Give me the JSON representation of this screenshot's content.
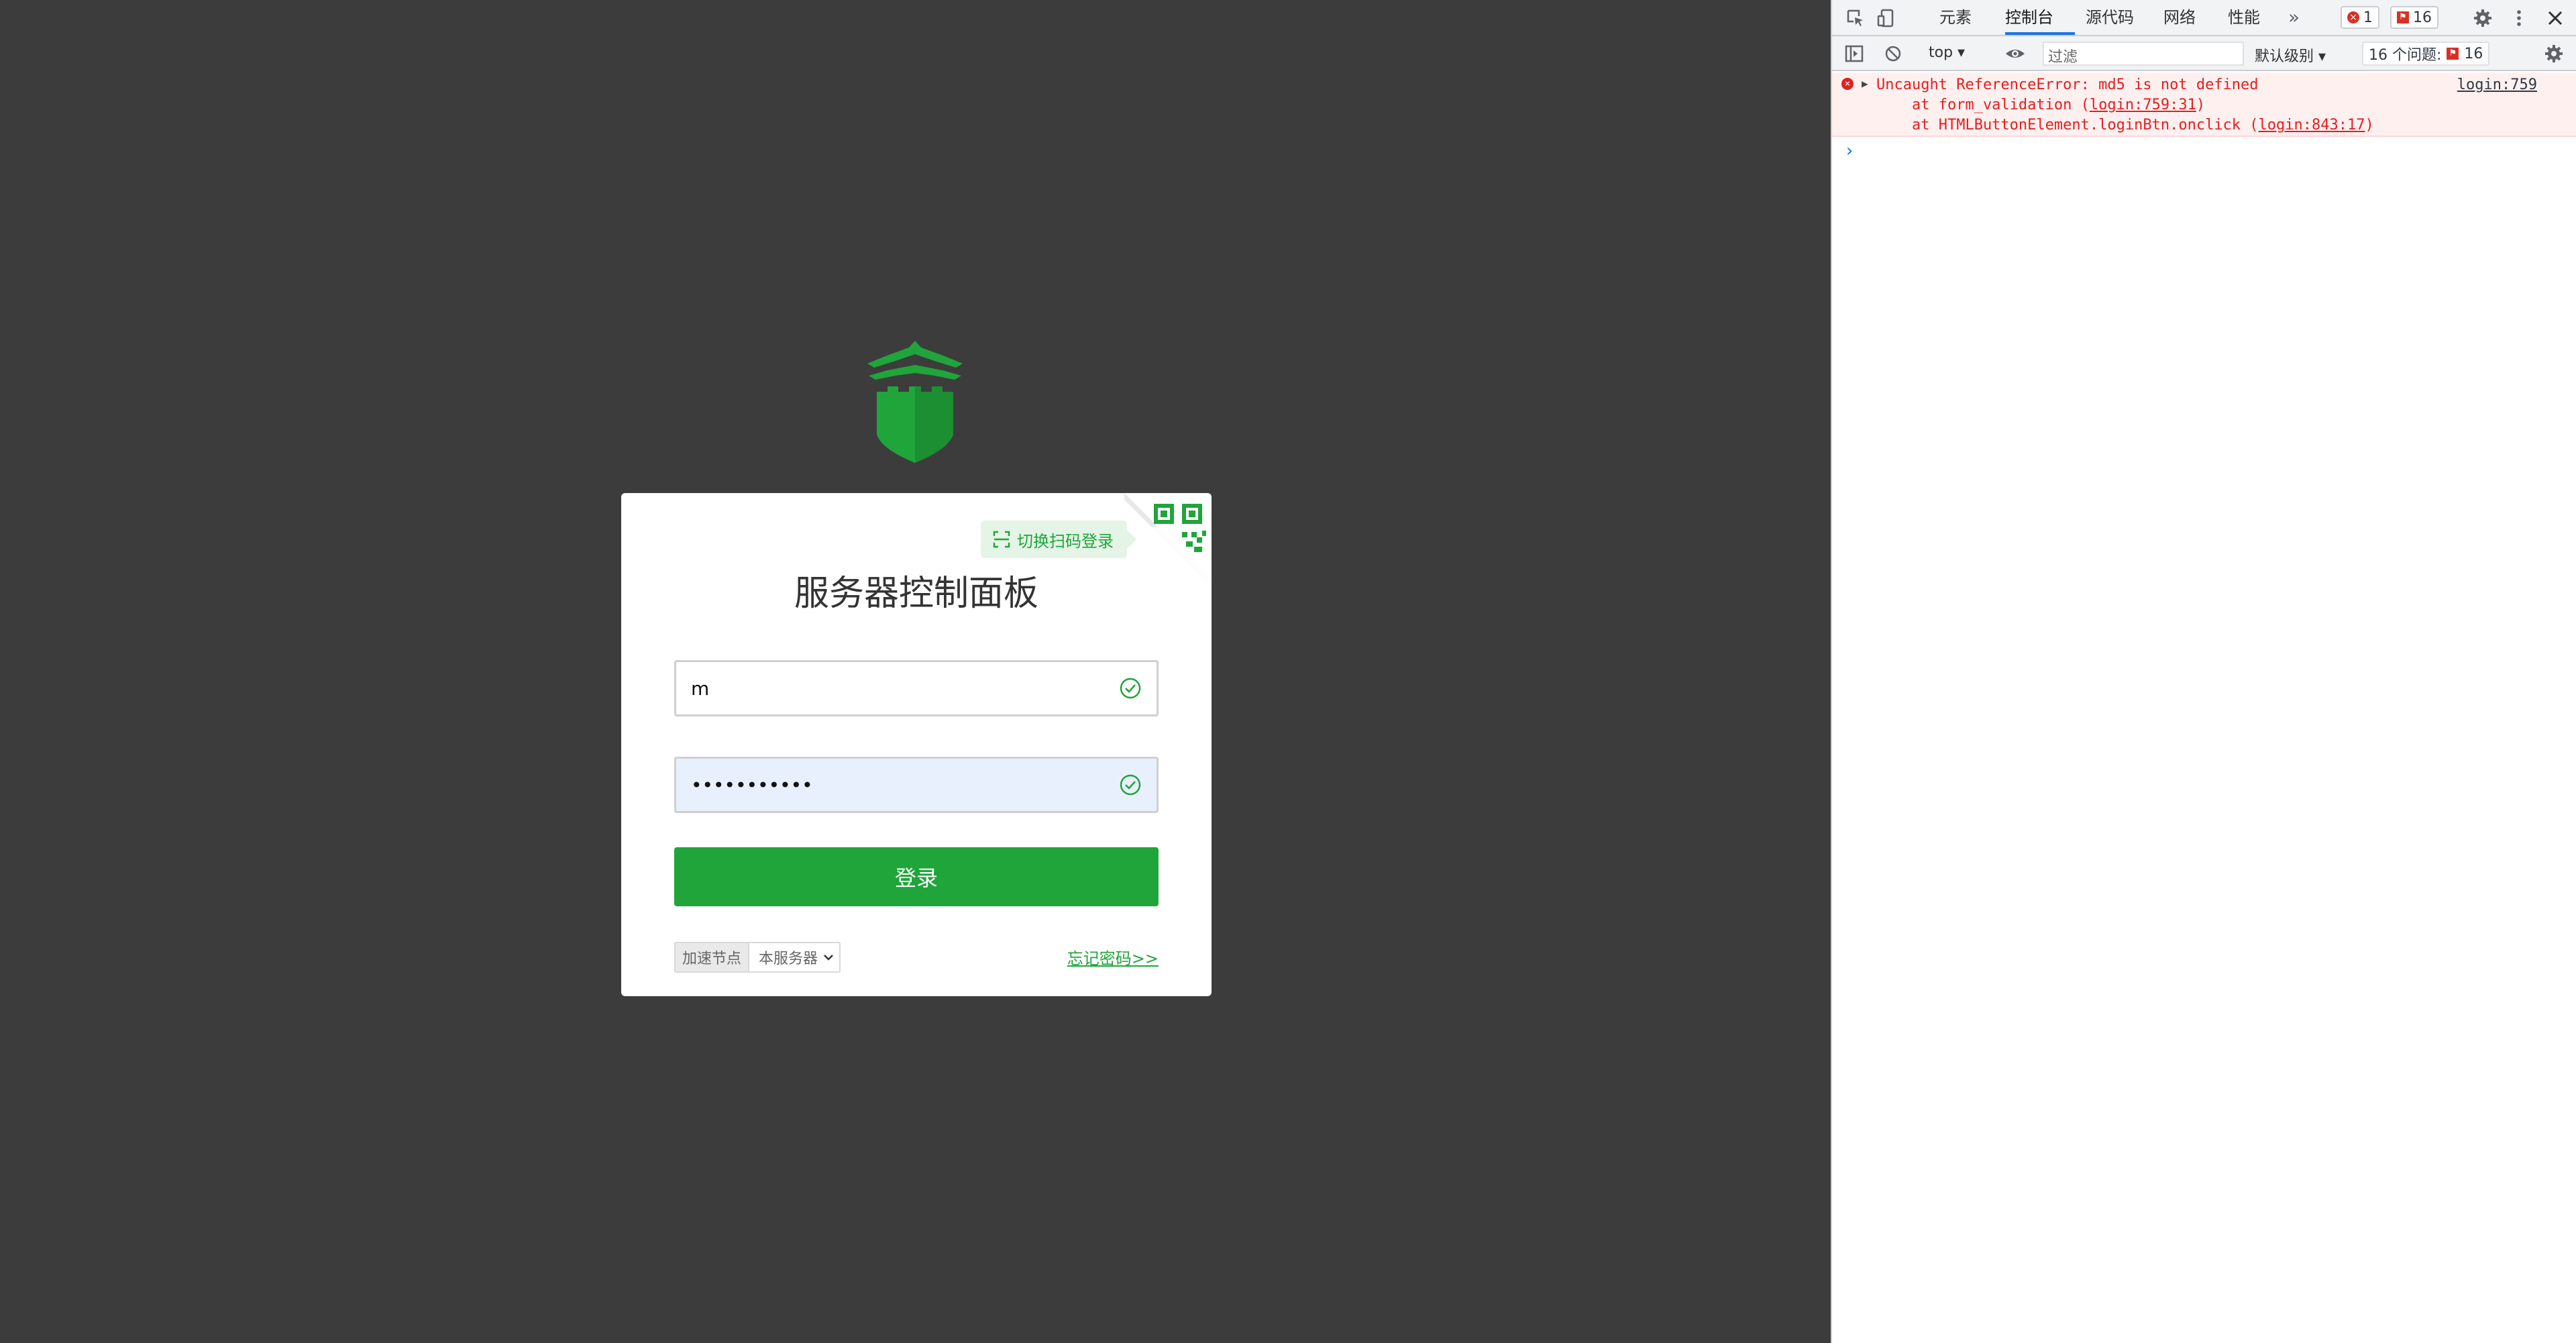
{
  "login": {
    "title": "服务器控制面板",
    "qr_tip": "切换扫码登录",
    "username_value": "m",
    "password_value": "•••••••••••",
    "login_button": "登录",
    "node_label": "加速节点",
    "node_selected": "本服务器",
    "forgot_link": "忘记密码>>"
  },
  "devtools": {
    "tabs": [
      "元素",
      "控制台",
      "源代码",
      "网络",
      "性能"
    ],
    "active_tab": "控制台",
    "error_count": "1",
    "issue_count": "16",
    "context": "top",
    "filter_placeholder": "过滤",
    "level": "默认级别",
    "issues_label": "16 个问题:",
    "issues_flag_count": "16",
    "error": {
      "message": "Uncaught ReferenceError: md5 is not defined",
      "source": "login:759",
      "frame1_prefix": "    at form_validation (",
      "frame1_link": "login:759:31",
      "frame1_suffix": ")",
      "frame2_prefix": "    at HTMLButtonElement.loginBtn.onclick (",
      "frame2_link": "login:843:17",
      "frame2_suffix": ")"
    },
    "prompt_symbol": "›"
  },
  "colors": {
    "brand_green": "#20a53a",
    "page_bg": "#3c3c3c",
    "error_red": "#e41e1e",
    "devtools_accent": "#1a73e8"
  },
  "icons": [
    "shield-logo-icon",
    "qr-code-icon",
    "scan-icon",
    "check-circle-icon",
    "chevron-down-icon",
    "gear-icon",
    "close-icon",
    "error-icon",
    "eye-icon",
    "block-icon",
    "inspect-icon",
    "device-icon",
    "sidebar-icon",
    "kebab-icon"
  ]
}
